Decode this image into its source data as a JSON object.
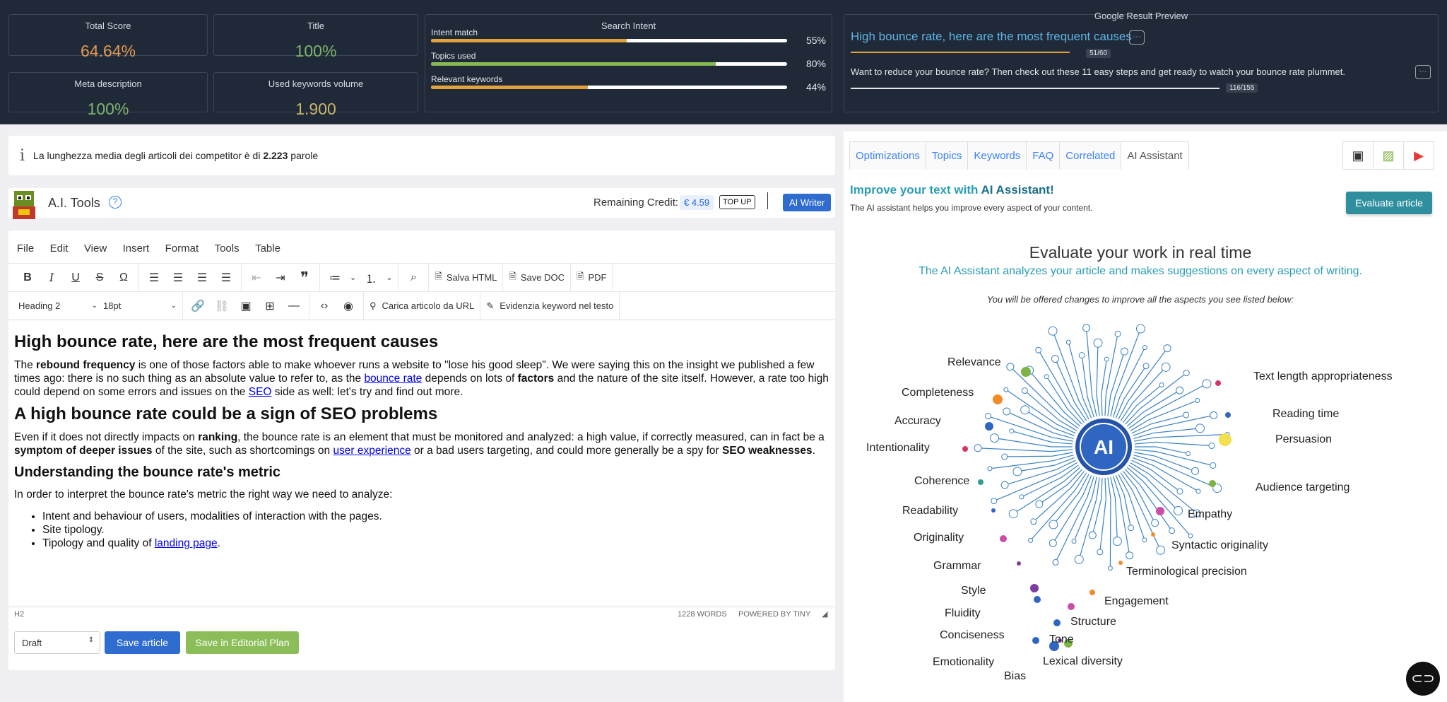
{
  "scores": {
    "total": {
      "label": "Total Score",
      "value": "64.64%"
    },
    "title": {
      "label": "Title",
      "value": "100%"
    },
    "meta": {
      "label": "Meta description",
      "value": "100%"
    },
    "keywords_volume": {
      "label": "Used keywords volume",
      "value": "1.900"
    }
  },
  "search_intent": {
    "label": "Search Intent",
    "bars": [
      {
        "label": "Intent match",
        "value": 55,
        "text": "55%",
        "color": "#e3a13b"
      },
      {
        "label": "Topics used",
        "value": 80,
        "text": "80%",
        "color": "#86b94f"
      },
      {
        "label": "Relevant keywords",
        "value": 44,
        "text": "44%",
        "color": "#e3a13b"
      }
    ]
  },
  "google_preview": {
    "label": "Google Result Preview",
    "title": "High bounce rate, here are the most frequent causes",
    "title_count": "51/60",
    "description": "Want to reduce your bounce rate? Then check out these 11 easy steps and get ready to watch your bounce rate plummet.",
    "desc_count": "116/155"
  },
  "info": {
    "text": "La lunghezza media degli articoli dei competitor è di ",
    "bold": "2.223",
    "suffix": " parole"
  },
  "ai_tools": {
    "title": "A.I. Tools",
    "credit_label": "Remaining Credit:",
    "credit_value": "€ 4.59",
    "topup": "TOP UP",
    "writer": "AI Writer"
  },
  "menu": [
    "File",
    "Edit",
    "View",
    "Insert",
    "Format",
    "Tools",
    "Table"
  ],
  "toolbar": {
    "salva_html": "Salva HTML",
    "save_doc": "Save DOC",
    "pdf": "PDF",
    "heading": "Heading 2",
    "size": "18pt",
    "carica": "Carica articolo da URL",
    "evidenzia": "Evidenzia keyword nel testo"
  },
  "editor": {
    "h1": "High bounce rate, here are the most frequent causes",
    "p1": {
      "a": "The ",
      "b1": "rebound frequency",
      "c": " is one of those factors able to make whoever runs a website to \"lose his good sleep\". We were saying this on the insight we published a few times ago: there is no such thing as an absolute value to refer to, as the ",
      "link1": "bounce rate",
      "d": " depends on lots of ",
      "b2": "factors",
      "e": " and the nature of the site itself. However, a rate too high could depend on some errors and issues on the ",
      "link2": "SEO",
      "f": " side as well: let's try and find out more."
    },
    "h2a": "A high bounce rate could be a sign of SEO problems",
    "p2": {
      "a": "Even if it does not directly impacts on ",
      "b1": "ranking",
      "c": ", the bounce rate is an element that must be monitored and analyzed: a high value, if correctly measured, can in fact be a ",
      "b2": "symptom of deeper issues",
      "d": " of the site, such as shortcomings on ",
      "link1": "user experience",
      "e": " or a bad users targeting, and could more generally be a spy for ",
      "b3": "SEO weaknesses",
      "f": "."
    },
    "h2b": "Understanding the bounce rate's metric",
    "p3": "In order to interpret the bounce rate's metric the right way we need to analyze:",
    "li1": "Intent and behaviour of users, modalities of interaction with the pages.",
    "li2": "Site tipology.",
    "li3a": "Tipology and quality of ",
    "li3link": "landing page",
    "li3b": ".",
    "status_left": "H2",
    "words": "1228 WORDS",
    "powered": "POWERED BY TINY"
  },
  "footer": {
    "status": "Draft",
    "save": "Save article",
    "editorial": "Save in Editorial Plan"
  },
  "right": {
    "tabs": [
      "Optimizations",
      "Topics",
      "Keywords",
      "FAQ",
      "Correlated",
      "AI Assistant"
    ],
    "heading_a": "Improve your text with ",
    "heading_b": "AI Assistant!",
    "sub": "The AI assistant helps you improve every aspect of your content.",
    "evaluate": "Evaluate article",
    "eval_title": "Evaluate your work in real time",
    "eval_sub": "The AI Assistant analyzes your article and makes suggestions on every aspect of writing.",
    "eval_note": "You will be offered changes to improve all the aspects you see listed below:",
    "ai_label": "AI",
    "aspects": [
      "Relevance",
      "Text length appropriateness",
      "Completeness",
      "Reading time",
      "Accuracy",
      "Persuasion",
      "Intentionality",
      "Coherence",
      "Audience targeting",
      "Readability",
      "Empathy",
      "Originality",
      "Syntactic originality",
      "Grammar",
      "Terminological precision",
      "Style",
      "Engagement",
      "Fluidity",
      "Structure",
      "Conciseness",
      "Tone",
      "Emotionality",
      "Lexical diversity",
      "Bias"
    ]
  }
}
